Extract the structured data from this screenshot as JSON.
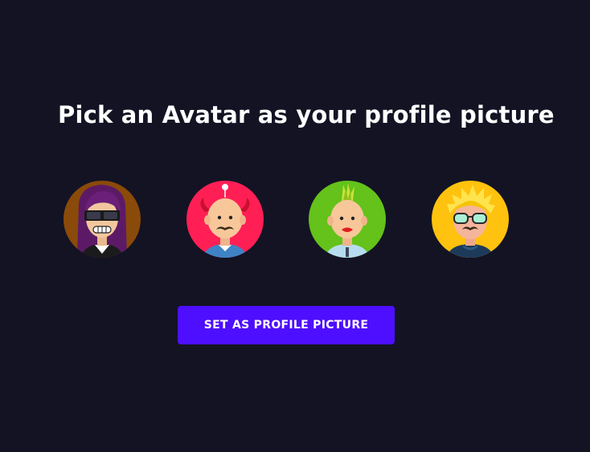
{
  "page": {
    "title": "Pick an Avatar as your profile picture",
    "button_label": "SET AS PROFILE PICTURE"
  },
  "avatars": [
    {
      "name": "avatar-woman-sunglasses",
      "background": "#8a4a0a"
    },
    {
      "name": "avatar-man-horns",
      "background": "#ff1f55"
    },
    {
      "name": "avatar-woman-mohawk",
      "background": "#64c21a"
    },
    {
      "name": "avatar-man-blonde-glasses",
      "background": "#ffc20e"
    }
  ],
  "colors": {
    "page_background": "#131324",
    "button_background": "#4e0eff",
    "title_text": "#ffffff"
  }
}
